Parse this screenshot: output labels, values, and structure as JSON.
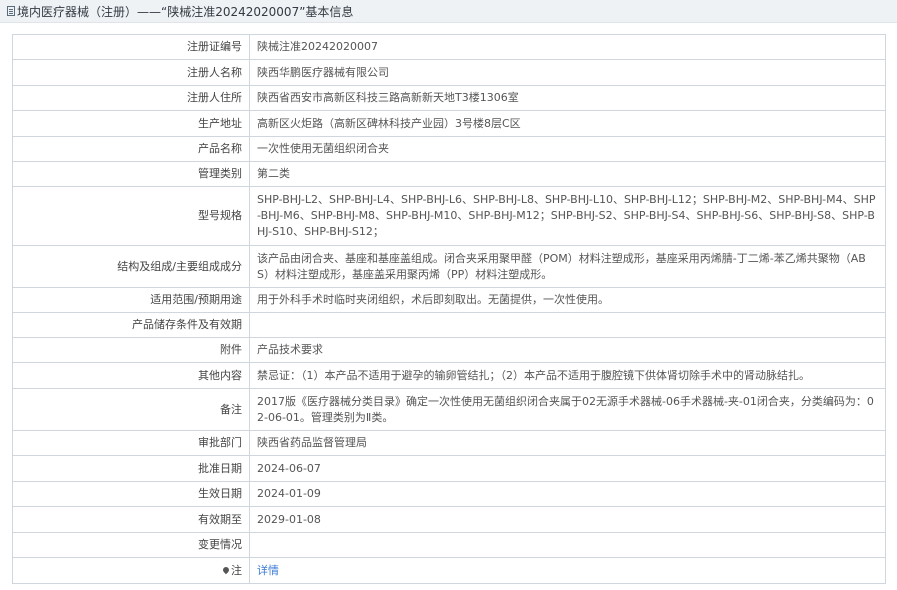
{
  "header": {
    "icon": "document-icon",
    "title": "境内医疗器械（注册）——“陕械注准20242020007”基本信息"
  },
  "rows": [
    {
      "label": "注册证编号",
      "value": "陕械注准20242020007"
    },
    {
      "label": "注册人名称",
      "value": "陕西华鹏医疗器械有限公司"
    },
    {
      "label": "注册人住所",
      "value": "陕西省西安市高新区科技三路高新新天地T3楼1306室"
    },
    {
      "label": "生产地址",
      "value": "高新区火炬路（高新区碑林科技产业园）3号楼8层C区"
    },
    {
      "label": "产品名称",
      "value": "一次性使用无菌组织闭合夹"
    },
    {
      "label": "管理类别",
      "value": "第二类"
    },
    {
      "label": "型号规格",
      "value": "SHP-BHJ-L2、SHP-BHJ-L4、SHP-BHJ-L6、SHP-BHJ-L8、SHP-BHJ-L10、SHP-BHJ-L12；SHP-BHJ-M2、SHP-BHJ-M4、SHP-BHJ-M6、SHP-BHJ-M8、SHP-BHJ-M10、SHP-BHJ-M12；SHP-BHJ-S2、SHP-BHJ-S4、SHP-BHJ-S6、SHP-BHJ-S8、SHP-BHJ-S10、SHP-BHJ-S12；"
    },
    {
      "label": "结构及组成/主要组成成分",
      "value": "该产品由闭合夹、基座和基座盖组成。闭合夹采用聚甲醛（POM）材料注塑成形，基座采用丙烯腈-丁二烯-苯乙烯共聚物（ABS）材料注塑成形，基座盖采用聚丙烯（PP）材料注塑成形。"
    },
    {
      "label": "适用范围/预期用途",
      "value": "用于外科手术时临时夹闭组织，术后即刻取出。无菌提供，一次性使用。"
    },
    {
      "label": "产品储存条件及有效期",
      "value": ""
    },
    {
      "label": "附件",
      "value": "产品技术要求"
    },
    {
      "label": "其他内容",
      "value": "禁忌证：（1）本产品不适用于避孕的输卵管结扎；（2）本产品不适用于腹腔镜下供体肾切除手术中的肾动脉结扎。"
    },
    {
      "label": "备注",
      "value": "2017版《医疗器械分类目录》确定一次性使用无菌组织闭合夹属于02无源手术器械-06手术器械-夹-01闭合夹，分类编码为：02-06-01。管理类别为Ⅱ类。"
    },
    {
      "label": "审批部门",
      "value": "陕西省药品监督管理局"
    },
    {
      "label": "批准日期",
      "value": "2024-06-07"
    },
    {
      "label": "生效日期",
      "value": "2024-01-09"
    },
    {
      "label": "有效期至",
      "value": "2029-01-08"
    },
    {
      "label": "变更情况",
      "value": ""
    }
  ],
  "note": {
    "icon": "pin-icon",
    "label": "注",
    "link": "详情"
  }
}
